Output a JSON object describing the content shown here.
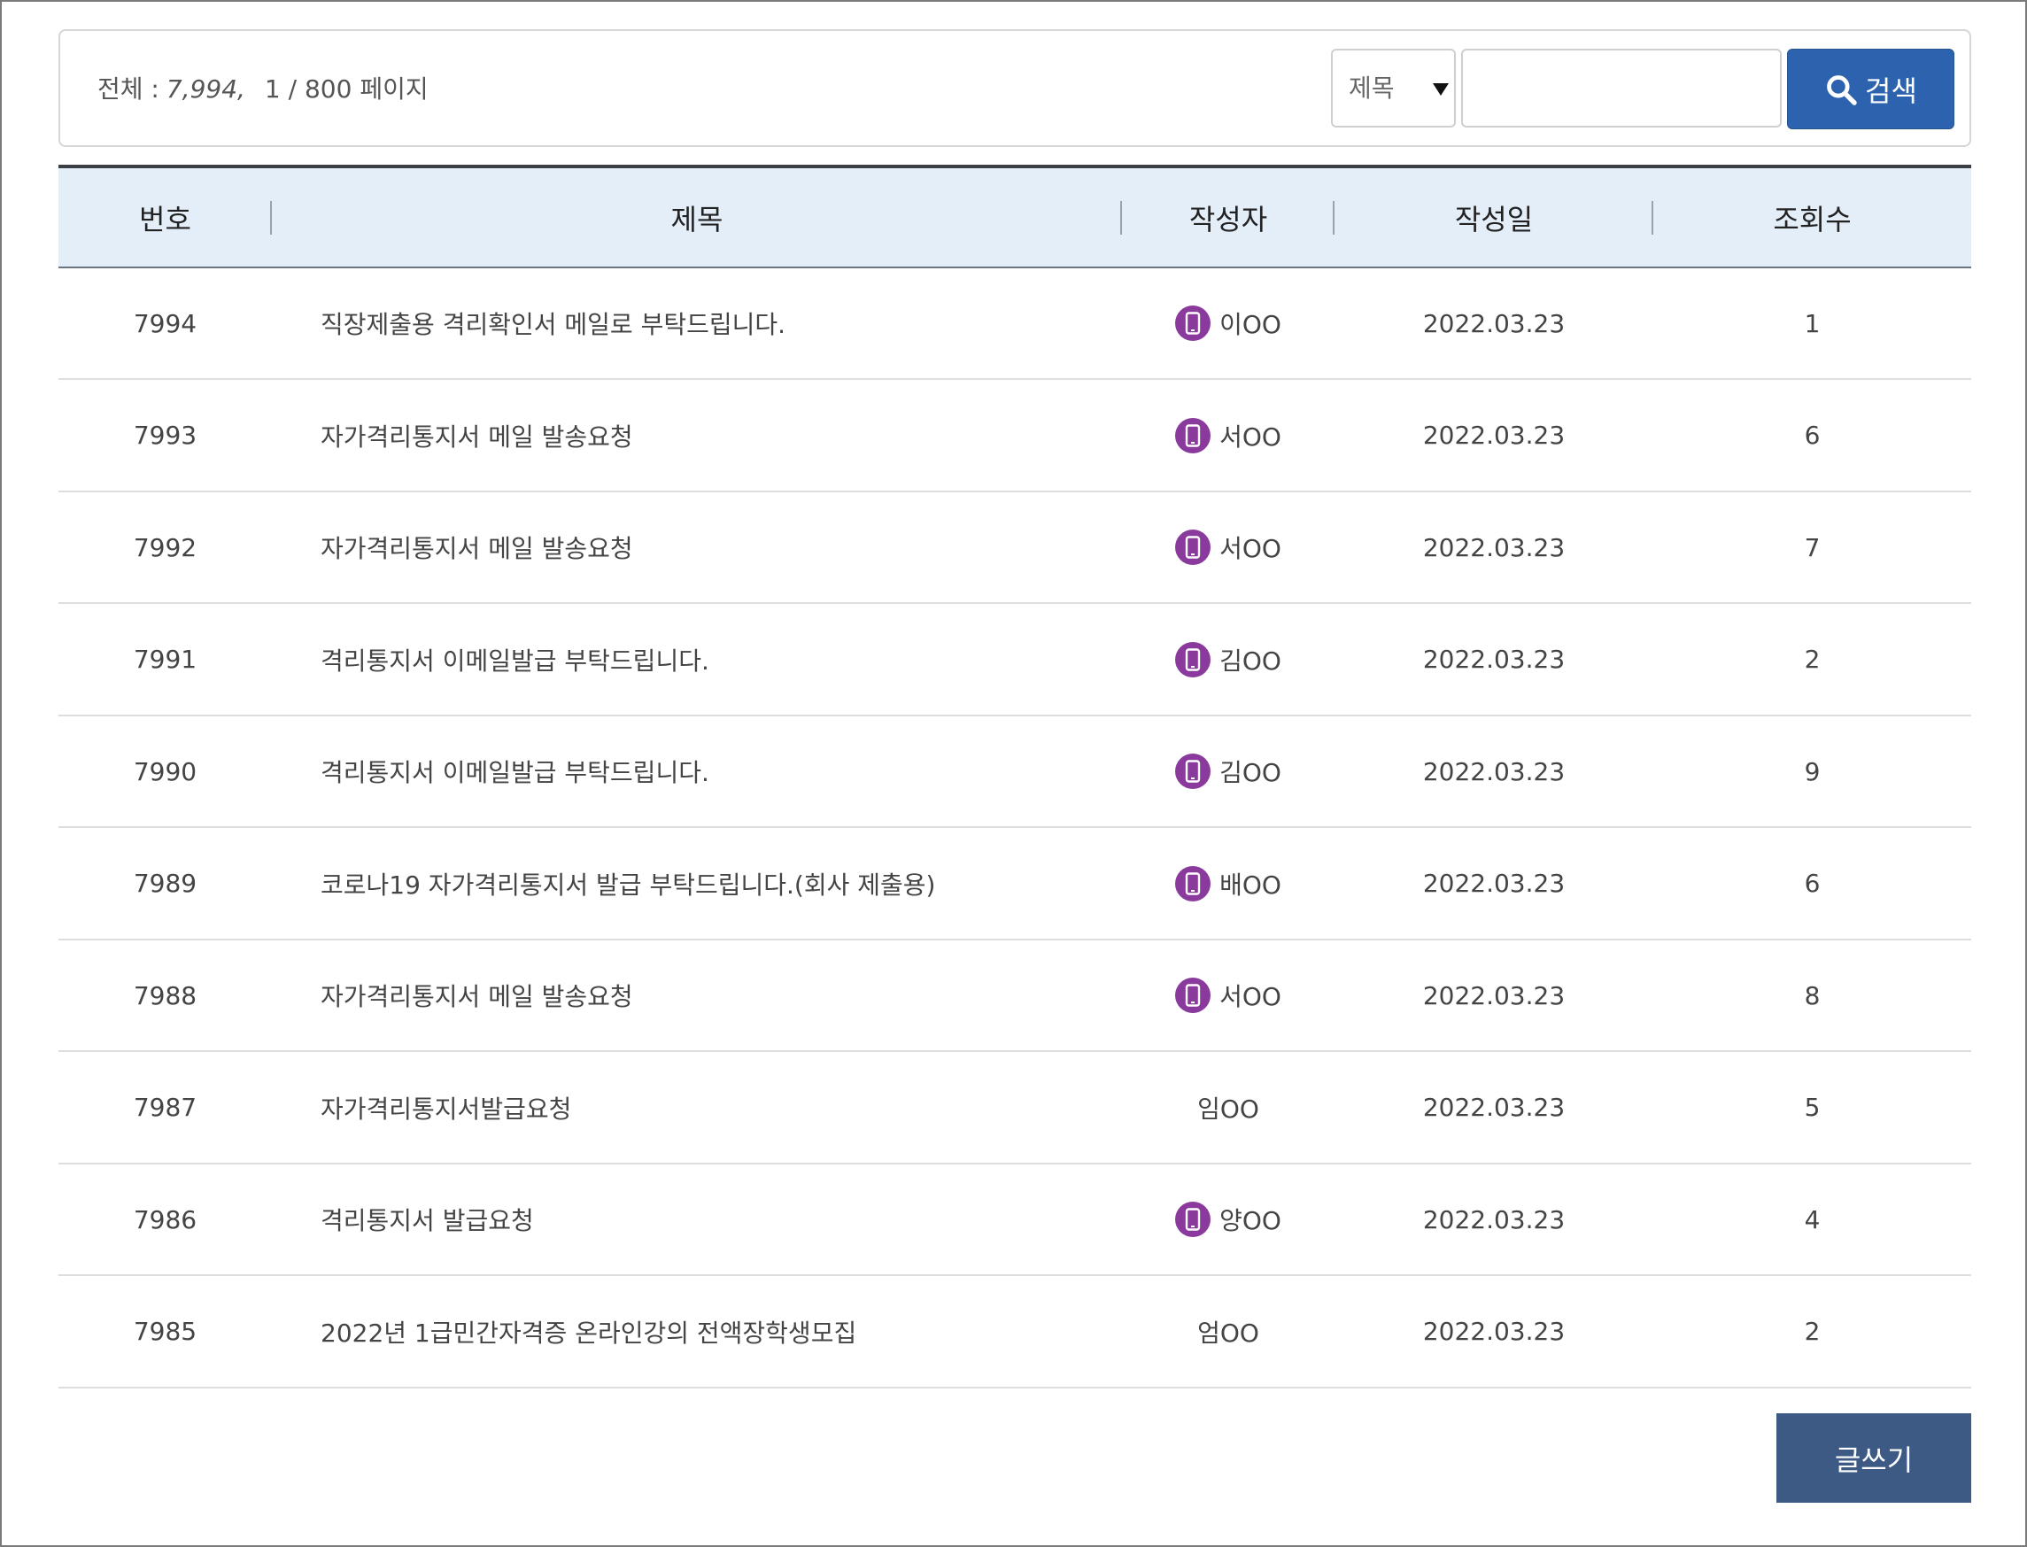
{
  "summary": {
    "total_label": "전체 :",
    "total_count": "7,994,",
    "page_info": "1 / 800 페이지"
  },
  "search": {
    "field_selected": "제목",
    "query_value": "",
    "button_label": "검색"
  },
  "table": {
    "headers": [
      "번호",
      "제목",
      "작성자",
      "작성일",
      "조회수"
    ],
    "rows": [
      {
        "no": "7994",
        "title": "직장제출용 격리확인서 메일로 부탁드립니다.",
        "author": "이OO",
        "mobile": true,
        "date": "2022.03.23",
        "views": "1"
      },
      {
        "no": "7993",
        "title": "자가격리통지서 메일 발송요청",
        "author": "서OO",
        "mobile": true,
        "date": "2022.03.23",
        "views": "6"
      },
      {
        "no": "7992",
        "title": "자가격리통지서 메일 발송요청",
        "author": "서OO",
        "mobile": true,
        "date": "2022.03.23",
        "views": "7"
      },
      {
        "no": "7991",
        "title": "격리통지서 이메일발급 부탁드립니다.",
        "author": "김OO",
        "mobile": true,
        "date": "2022.03.23",
        "views": "2"
      },
      {
        "no": "7990",
        "title": "격리통지서 이메일발급 부탁드립니다.",
        "author": "김OO",
        "mobile": true,
        "date": "2022.03.23",
        "views": "9"
      },
      {
        "no": "7989",
        "title": "코로나19 자가격리통지서 발급 부탁드립니다.(회사 제출용)",
        "author": "배OO",
        "mobile": true,
        "date": "2022.03.23",
        "views": "6"
      },
      {
        "no": "7988",
        "title": "자가격리통지서 메일 발송요청",
        "author": "서OO",
        "mobile": true,
        "date": "2022.03.23",
        "views": "8"
      },
      {
        "no": "7987",
        "title": "자가격리통지서발급요청",
        "author": "임OO",
        "mobile": false,
        "date": "2022.03.23",
        "views": "5"
      },
      {
        "no": "7986",
        "title": "격리통지서 발급요청",
        "author": "양OO",
        "mobile": true,
        "date": "2022.03.23",
        "views": "4"
      },
      {
        "no": "7985",
        "title": "2022년 1급민간자격증 온라인강의 전액장학생모집",
        "author": "엄OO",
        "mobile": false,
        "date": "2022.03.23",
        "views": "2"
      }
    ]
  },
  "actions": {
    "write_label": "글쓰기"
  },
  "colors": {
    "header_bg": "#e4eef9",
    "search_button": "#2d63ae",
    "write_button": "#3d5a85",
    "mobile_badge": "#8a3a9c"
  },
  "icons": {
    "search": "magnifier-icon",
    "mobile": "mobile-phone-icon",
    "dropdown": "caret-down-icon"
  }
}
